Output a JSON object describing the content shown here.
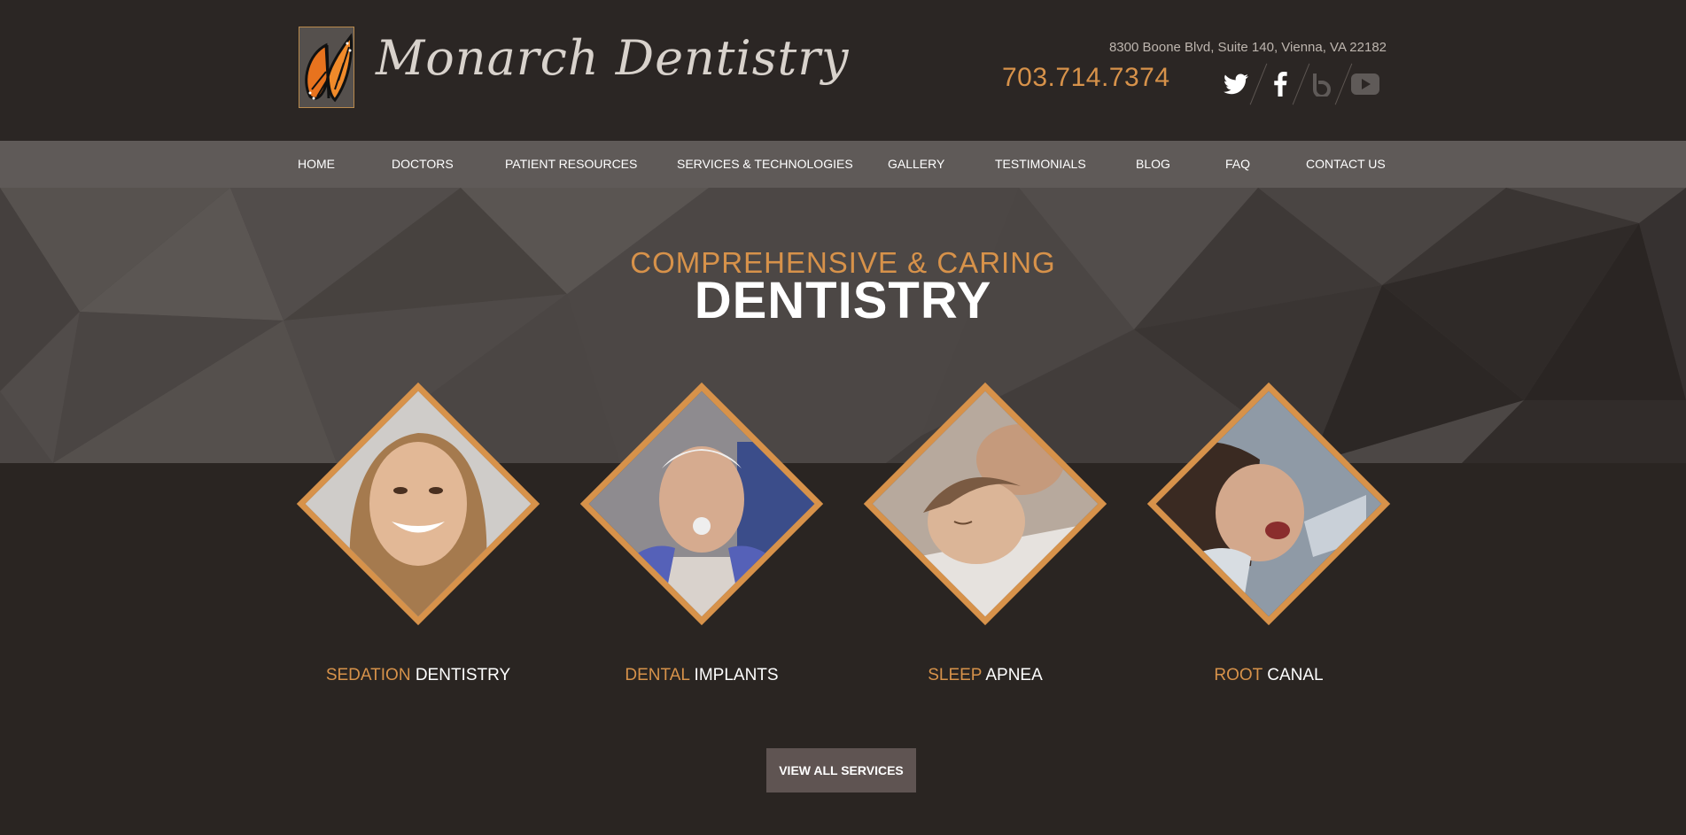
{
  "header": {
    "logo_text": "Monarch Dentistry",
    "address": "8300 Boone Blvd, Suite 140, Vienna, VA 22182",
    "phone": "703.714.7374",
    "socials": [
      "twitter-icon",
      "facebook-icon",
      "blog-icon",
      "youtube-icon"
    ]
  },
  "nav": {
    "items": [
      {
        "label": "HOME"
      },
      {
        "label": "DOCTORS"
      },
      {
        "label": "PATIENT RESOURCES"
      },
      {
        "label": "SERVICES & TECHNOLOGIES"
      },
      {
        "label": "GALLERY"
      },
      {
        "label": "TESTIMONIALS"
      },
      {
        "label": "BLOG"
      },
      {
        "label": "FAQ"
      },
      {
        "label": "CONTACT US"
      }
    ]
  },
  "hero": {
    "subtitle": "COMPREHENSIVE & CARING",
    "title": "DENTISTRY"
  },
  "services": [
    {
      "accent": "SEDATION",
      "rest": "DENTISTRY"
    },
    {
      "accent": "DENTAL",
      "rest": "IMPLANTS"
    },
    {
      "accent": "SLEEP",
      "rest": "APNEA"
    },
    {
      "accent": "ROOT",
      "rest": "CANAL"
    }
  ],
  "cta": {
    "label": "VIEW ALL SERVICES"
  },
  "colors": {
    "accent": "#d7924a",
    "background": "#2a2522",
    "nav": "#5f5a58"
  }
}
